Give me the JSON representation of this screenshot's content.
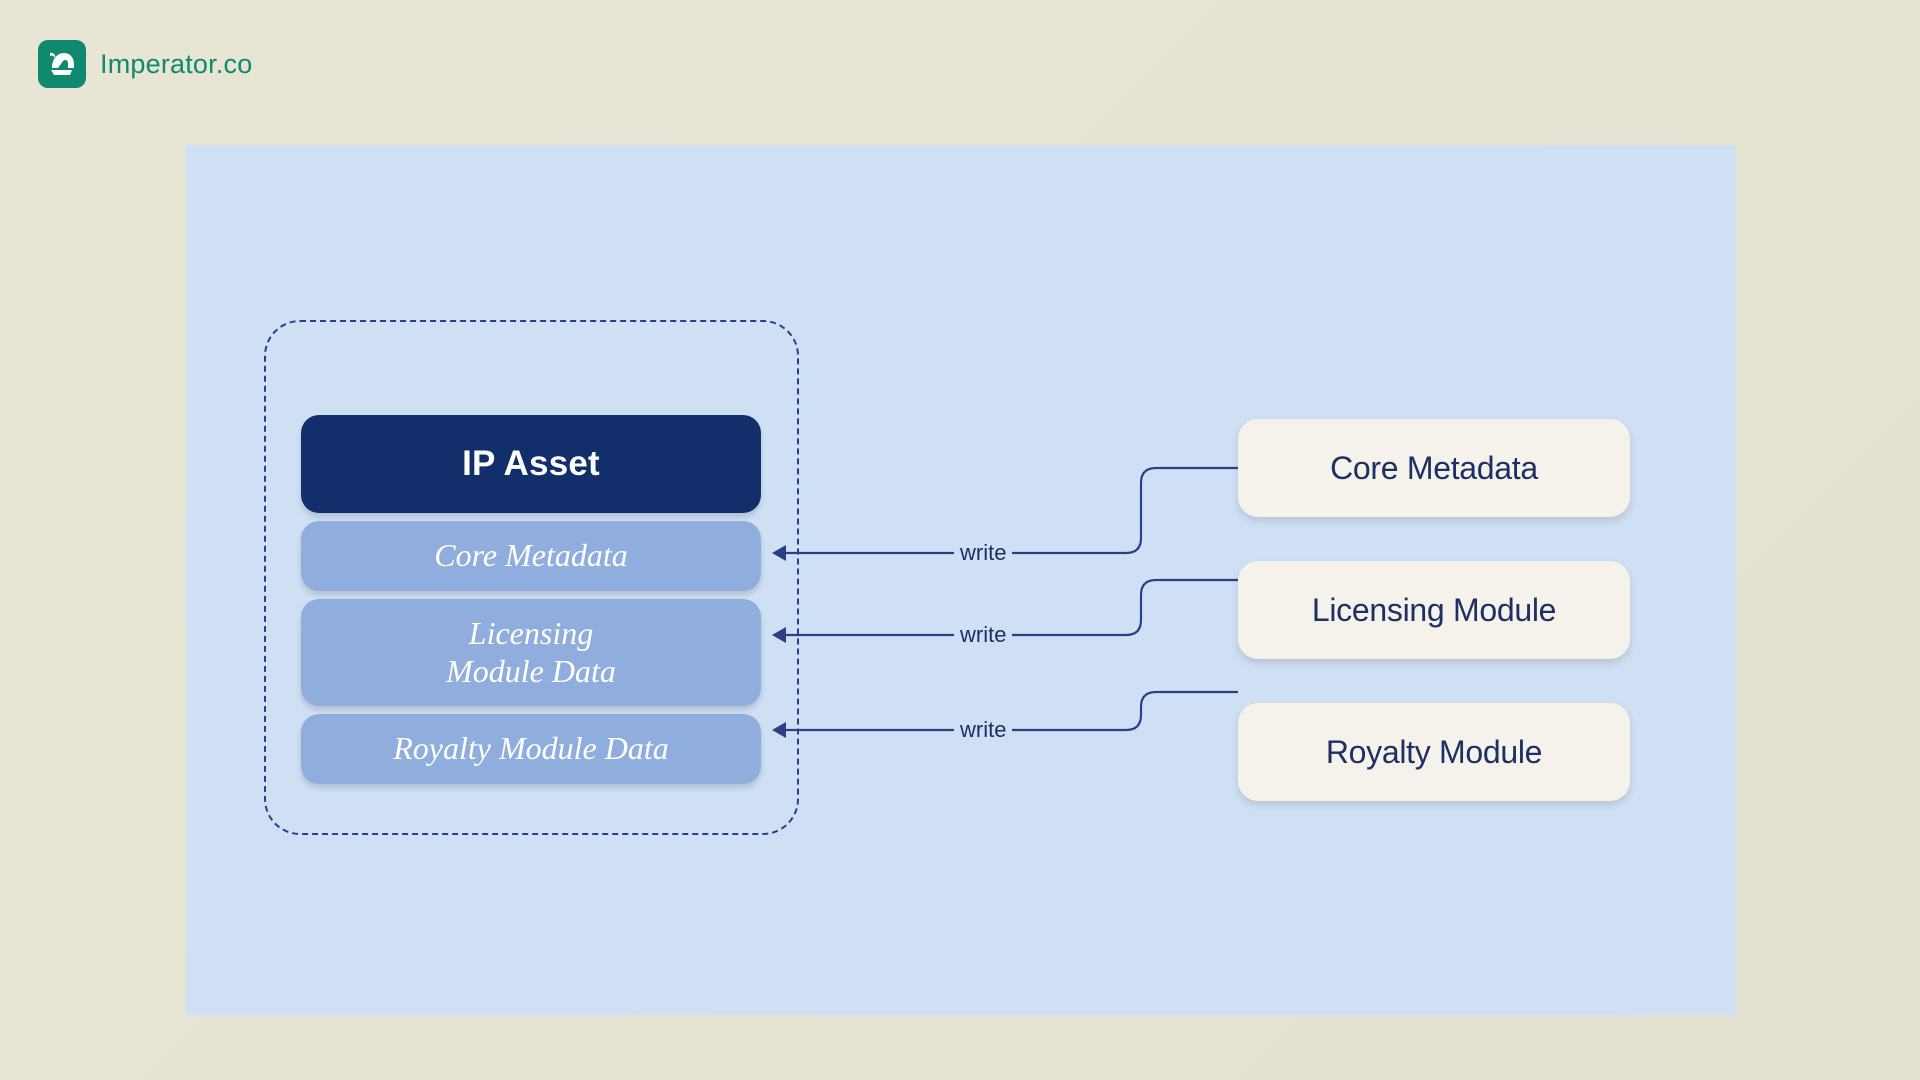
{
  "brand": {
    "name": "Imperator.co"
  },
  "asset": {
    "header": "IP Asset",
    "rows": {
      "core": "Core Metadata",
      "licensing": "Licensing\nModule Data",
      "royalty": "Royalty Module Data"
    }
  },
  "modules": {
    "core": "Core Metadata",
    "licensing": "Licensing Module",
    "royalty": "Royalty Module"
  },
  "edge_label": "write",
  "colors": {
    "brand": "#0f8a6e",
    "deep_navy": "#122e6b",
    "mid_blue": "#8faede",
    "line": "#2a3f85",
    "card": "#f4f2ea",
    "canvas": "#cfe0f4"
  }
}
